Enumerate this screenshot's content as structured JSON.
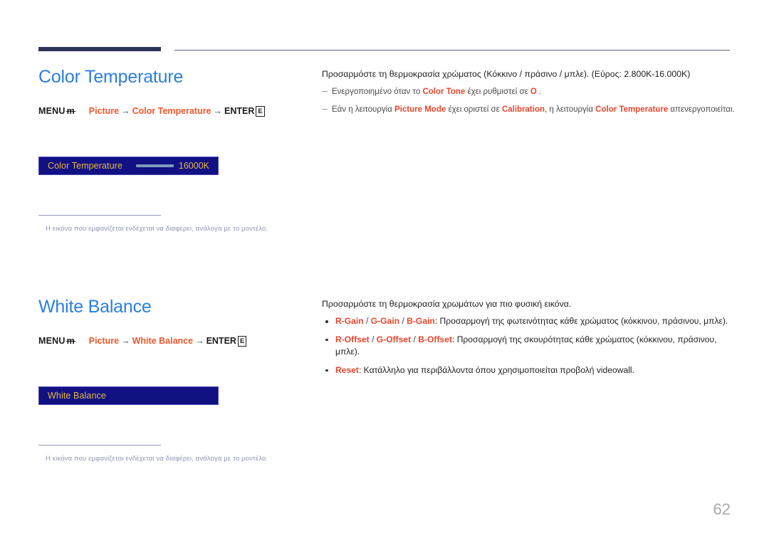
{
  "document": {
    "page_number": "62"
  },
  "colors": {
    "heading_blue": "#2a7de1",
    "accent_orange": "#f2562a",
    "highlight_red": "#e8452c",
    "rule_navy": "#2b3557",
    "osd_background": "#111184",
    "osd_text_gold": "#e8b93c",
    "note_gray": "#8e94b3",
    "page_number_gray": "#a8a8a8"
  },
  "sections": [
    {
      "id": "color-temperature",
      "title": "Color Temperature",
      "menu_prefix": "MENU",
      "menu_glyph": "m",
      "path_root": "Picture",
      "path_leaf": "Color Temperature",
      "path_arrow": "→",
      "enter_label": "ENTER",
      "enter_glyph": "E",
      "osd": {
        "label": "Color Temperature",
        "value": "16000K",
        "has_slider": true
      },
      "note": "Η εικόνα που εμφανίζεται ενδέχεται να διαφέρει, ανάλογα με το μοντέλο.",
      "description": {
        "intro": "Προσαρμόστε τη θερμοκρασία χρώματος (Κόκκινο / πράσινο / μπλε). (Εύρος: 2.800K-16.000K)",
        "subnotes": [
          {
            "parts": [
              {
                "text": "Ενεργοποιημένο όταν το ",
                "style": "plain"
              },
              {
                "text": "Color Tone",
                "style": "highlight"
              },
              {
                "text": " έχει ρυθμιστεί σε ",
                "style": "plain"
              },
              {
                "text": "O",
                "style": "highlight"
              },
              {
                "text": "  .",
                "style": "plain"
              }
            ]
          },
          {
            "parts": [
              {
                "text": "Εάν η λειτουργία ",
                "style": "plain"
              },
              {
                "text": "Picture Mode",
                "style": "highlight"
              },
              {
                "text": " έχει οριστεί σε ",
                "style": "plain"
              },
              {
                "text": "Calibration",
                "style": "highlight"
              },
              {
                "text": ", η λειτουργία ",
                "style": "plain"
              },
              {
                "text": "Color Temperature",
                "style": "highlight"
              },
              {
                "text": " απενεργοποιείται.",
                "style": "plain"
              }
            ]
          }
        ],
        "bullets": []
      }
    },
    {
      "id": "white-balance",
      "title": "White Balance",
      "menu_prefix": "MENU",
      "menu_glyph": "m",
      "path_root": "Picture",
      "path_leaf": "White Balance",
      "path_arrow": "→",
      "enter_label": "ENTER",
      "enter_glyph": "E",
      "osd": {
        "label": "White Balance",
        "value": "",
        "has_slider": false
      },
      "note": "Η εικόνα που εμφανίζεται ενδέχεται να διαφέρει, ανάλογα με το μοντέλο.",
      "description": {
        "intro": "Προσαρμόστε τη θερμοκρασία χρωμάτων για πιο φυσική εικόνα.",
        "subnotes": [],
        "bullets": [
          {
            "parts": [
              {
                "text": "R-Gain",
                "style": "highlight"
              },
              {
                "text": " / ",
                "style": "sep"
              },
              {
                "text": "G-Gain",
                "style": "highlight"
              },
              {
                "text": " / ",
                "style": "sep"
              },
              {
                "text": "B-Gain",
                "style": "highlight"
              },
              {
                "text": ": Προσαρμογή της φωτεινότητας κάθε χρώματος (κόκκινου, πράσινου, μπλε).",
                "style": "plain"
              }
            ]
          },
          {
            "parts": [
              {
                "text": "R-Offset",
                "style": "highlight"
              },
              {
                "text": " / ",
                "style": "sep"
              },
              {
                "text": "G-Offset",
                "style": "highlight"
              },
              {
                "text": " / ",
                "style": "sep"
              },
              {
                "text": "B-Offset",
                "style": "highlight"
              },
              {
                "text": ": Προσαρμογή της σκουρότητας κάθε χρώματος (κόκκινου, πράσινου, μπλε).",
                "style": "plain"
              }
            ]
          },
          {
            "parts": [
              {
                "text": "Reset",
                "style": "highlight"
              },
              {
                "text": ": Κατάλληλο για περιβάλλοντα όπου χρησιμοποιείται προβολή videowall.",
                "style": "plain"
              }
            ]
          }
        ]
      }
    }
  ]
}
